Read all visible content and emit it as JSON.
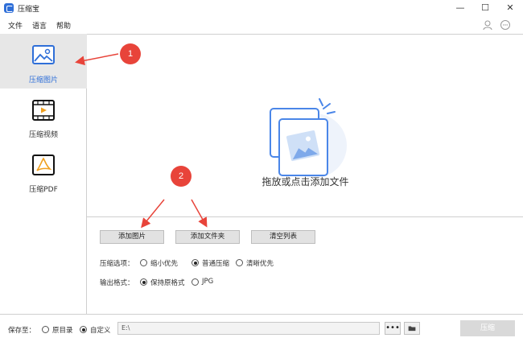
{
  "window": {
    "title": "压缩宝",
    "minimize": "—",
    "maximize": "☐",
    "close": "✕"
  },
  "menu": {
    "file": "文件",
    "language": "语言",
    "help": "帮助"
  },
  "sidebar": {
    "items": [
      {
        "label": "压缩图片",
        "icon": "image-icon",
        "active": true
      },
      {
        "label": "压缩视频",
        "icon": "video-icon",
        "active": false
      },
      {
        "label": "压缩PDF",
        "icon": "pdf-icon",
        "active": false
      }
    ]
  },
  "drop_area": {
    "text": "拖放或点击添加文件"
  },
  "buttons": {
    "add_image": "添加图片",
    "add_folder": "添加文件夹",
    "clear_list": "清空列表"
  },
  "options": {
    "compress_label": "压缩选项：",
    "compress_choices": [
      "缩小优先",
      "普通压缩",
      "清晰优先"
    ],
    "compress_selected": "普通压缩",
    "format_label": "输出格式：",
    "format_choices": [
      "保持原格式",
      "JPG"
    ],
    "format_selected": "保持原格式"
  },
  "save": {
    "label": "保存至：",
    "choices": [
      "原目录",
      "自定义"
    ],
    "selected": "自定义",
    "path": "E:\\",
    "browse_label": "•••",
    "compress_label": "压缩"
  },
  "annotations": {
    "marker1": "1",
    "marker2": "2"
  },
  "colors": {
    "accent": "#2f6fd8",
    "marker": "#e8443a",
    "arrow": "#e8443a"
  }
}
